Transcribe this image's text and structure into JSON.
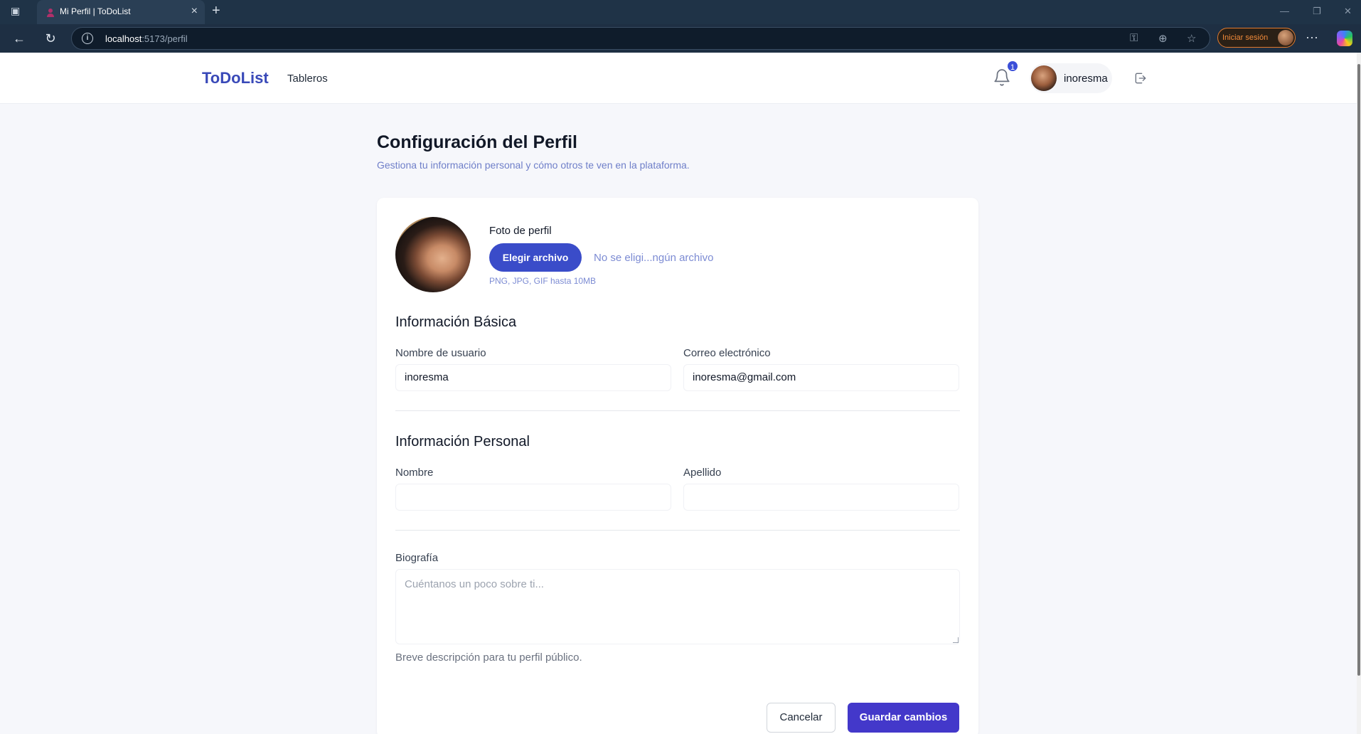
{
  "browser": {
    "tab_title": "Mi Perfil | ToDoList",
    "url_host": "localhost",
    "url_path": ":5173/perfil",
    "signin_label": "Iniciar sesión"
  },
  "header": {
    "brand": "ToDoList",
    "nav_boards": "Tableros",
    "notification_count": "1",
    "username": "inoresma"
  },
  "page": {
    "title": "Configuración del Perfil",
    "subtitle": "Gestiona tu información personal y cómo otros te ven en la plataforma."
  },
  "photo": {
    "label": "Foto de perfil",
    "choose_button": "Elegir archivo",
    "no_file": "No se eligi...ngún archivo",
    "hint": "PNG, JPG, GIF hasta 10MB"
  },
  "basic_info": {
    "title": "Información Básica",
    "username_label": "Nombre de usuario",
    "username_value": "inoresma",
    "email_label": "Correo electrónico",
    "email_value": "inoresma@gmail.com"
  },
  "personal_info": {
    "title": "Información Personal",
    "first_name_label": "Nombre",
    "first_name_value": "",
    "last_name_label": "Apellido",
    "last_name_value": ""
  },
  "bio": {
    "label": "Biografía",
    "placeholder": "Cuéntanos un poco sobre ti...",
    "hint": "Breve descripción para tu perfil público."
  },
  "actions": {
    "cancel": "Cancelar",
    "save": "Guardar cambios"
  },
  "colors": {
    "brand": "#3949b8",
    "primary_button": "#3a4cc9",
    "save_button": "#4338ca",
    "muted_link": "#7c8bd3"
  }
}
